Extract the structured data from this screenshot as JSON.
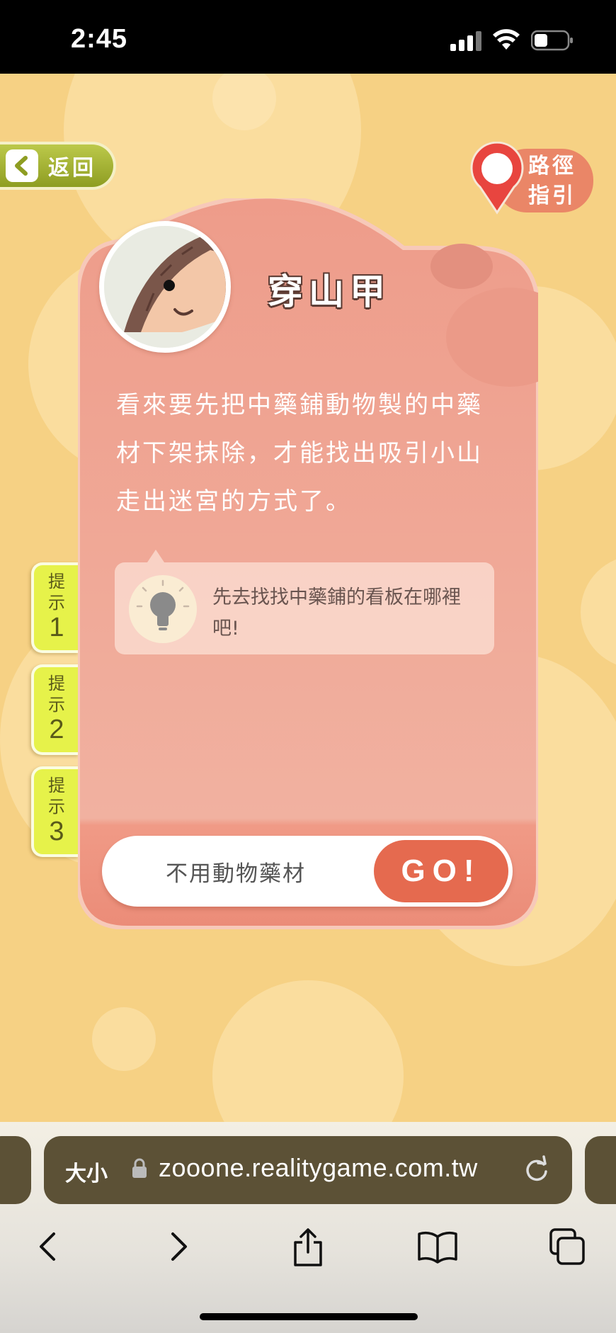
{
  "status_bar": {
    "time": "2:45"
  },
  "nav": {
    "back_label": "返回",
    "route_label_line1": "路徑",
    "route_label_line2": "指引"
  },
  "hints": [
    {
      "label": "提示",
      "number": "1"
    },
    {
      "label": "提示",
      "number": "2"
    },
    {
      "label": "提示",
      "number": "3"
    }
  ],
  "card": {
    "animal_name": "穿山甲",
    "story_lines": [
      "看來要先把中藥鋪動物製的中藥",
      "材下架抹除，才能找出吸引小山",
      "走出迷宮的方式了。"
    ],
    "hint_text": "先去找找中藥鋪的看板在哪裡吧!",
    "answer_value": "不用動物藥材",
    "go_label": "GO!"
  },
  "colors": {
    "background": "#f6d184",
    "card": "#eea391",
    "go_button": "#e56a4f",
    "back_button": "#a3b236",
    "hint_tab": "#e6f24a",
    "url_bar": "#5c5136"
  },
  "browser": {
    "text_size_label": "大小",
    "url": "zooone.realitygame.com.tw"
  },
  "icons": {
    "back": "chevron-left-icon",
    "route": "map-pin-icon",
    "hint": "lightbulb-icon",
    "lock": "lock-icon",
    "reload": "reload-icon",
    "toolbar": [
      "chevron-left-icon",
      "chevron-right-icon",
      "share-icon",
      "book-icon",
      "tabs-icon"
    ]
  }
}
